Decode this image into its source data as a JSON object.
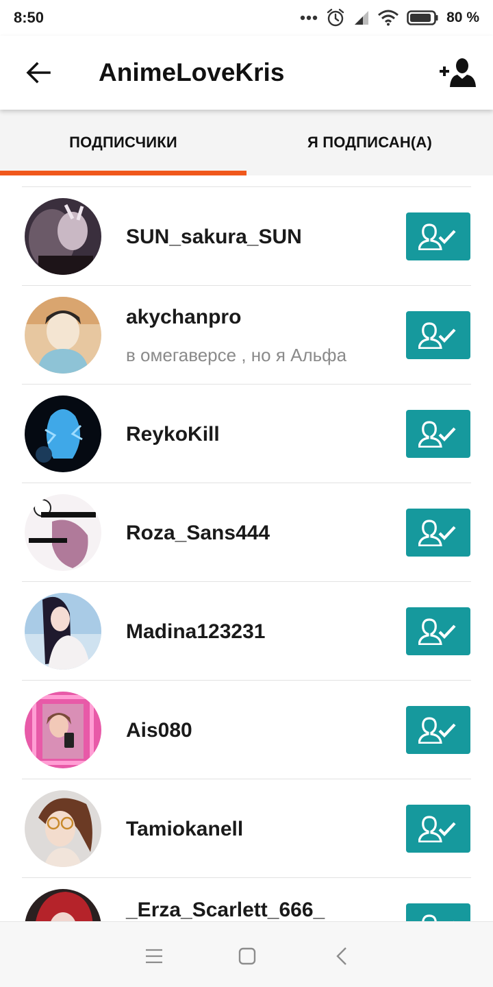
{
  "status_bar": {
    "time": "8:50",
    "battery": "80 %",
    "icons": [
      "more-dots-icon",
      "alarm-icon",
      "signal-icon",
      "wifi-icon",
      "battery-icon"
    ]
  },
  "header": {
    "title": "AnimeLoveKris",
    "back_icon": "arrow-left-icon",
    "add_user_icon": "add-user-icon"
  },
  "tabs": [
    {
      "label": "ПОДПИСЧИКИ",
      "active": true
    },
    {
      "label": "Я ПОДПИСАН(А)",
      "active": false
    }
  ],
  "accent_color": "#f0581c",
  "button_color": "#16999d",
  "users": [
    {
      "name": "SUN_sakura_SUN",
      "status": ""
    },
    {
      "name": "akychanpro",
      "status": "в омегаверсе , но я Альфа"
    },
    {
      "name": "ReykoKill",
      "status": ""
    },
    {
      "name": "Roza_Sans444",
      "status": ""
    },
    {
      "name": "Madina123231",
      "status": ""
    },
    {
      "name": "Ais080",
      "status": ""
    },
    {
      "name": "Tamiokanell",
      "status": ""
    },
    {
      "name": "_Erza_Scarlett_666_",
      "status": ""
    }
  ],
  "nav": {
    "icons": [
      "menu-icon",
      "home-square-icon",
      "back-chevron-icon"
    ]
  }
}
